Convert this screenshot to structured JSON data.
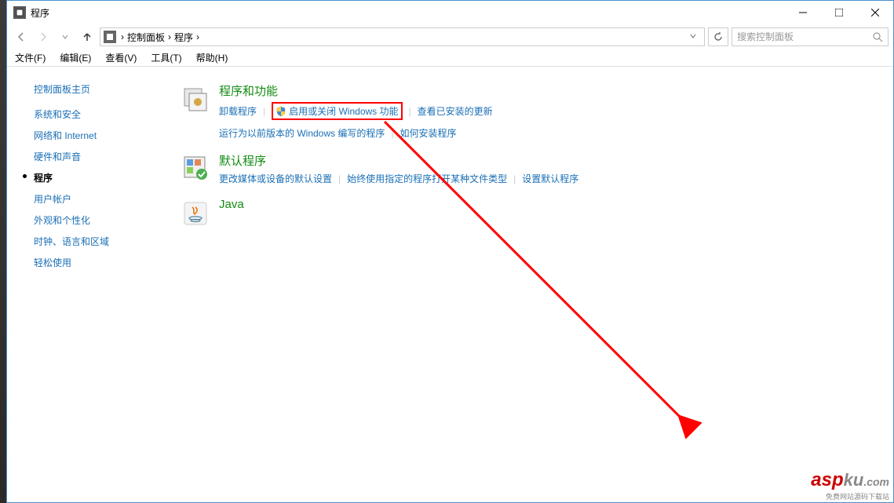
{
  "window": {
    "title": "程序"
  },
  "breadcrumb": {
    "root": "控制面板",
    "current": "程序"
  },
  "search": {
    "placeholder": "搜索控制面板"
  },
  "menubar": {
    "file": "文件(F)",
    "edit": "编辑(E)",
    "view": "查看(V)",
    "tools": "工具(T)",
    "help": "帮助(H)"
  },
  "sidebar": {
    "title": "控制面板主页",
    "items": [
      {
        "label": "系统和安全",
        "active": false
      },
      {
        "label": "网络和 Internet",
        "active": false
      },
      {
        "label": "硬件和声音",
        "active": false
      },
      {
        "label": "程序",
        "active": true
      },
      {
        "label": "用户帐户",
        "active": false
      },
      {
        "label": "外观和个性化",
        "active": false
      },
      {
        "label": "时钟、语言和区域",
        "active": false
      },
      {
        "label": "轻松使用",
        "active": false
      }
    ]
  },
  "main": {
    "programs_features": {
      "title": "程序和功能",
      "links": {
        "uninstall": "卸载程序",
        "windows_features": "启用或关闭 Windows 功能",
        "view_updates": "查看已安装的更新",
        "run_old": "运行为以前版本的 Windows 编写的程序",
        "how_install": "如何安装程序"
      }
    },
    "default_programs": {
      "title": "默认程序",
      "links": {
        "change_defaults": "更改媒体或设备的默认设置",
        "always_open": "始终使用指定的程序打开某种文件类型",
        "set_defaults": "设置默认程序"
      }
    },
    "java": {
      "title": "Java"
    }
  },
  "watermark": {
    "text1": "asp",
    "text2": "ku",
    "text3": ".com",
    "sub": "免费网站源码下载站"
  }
}
